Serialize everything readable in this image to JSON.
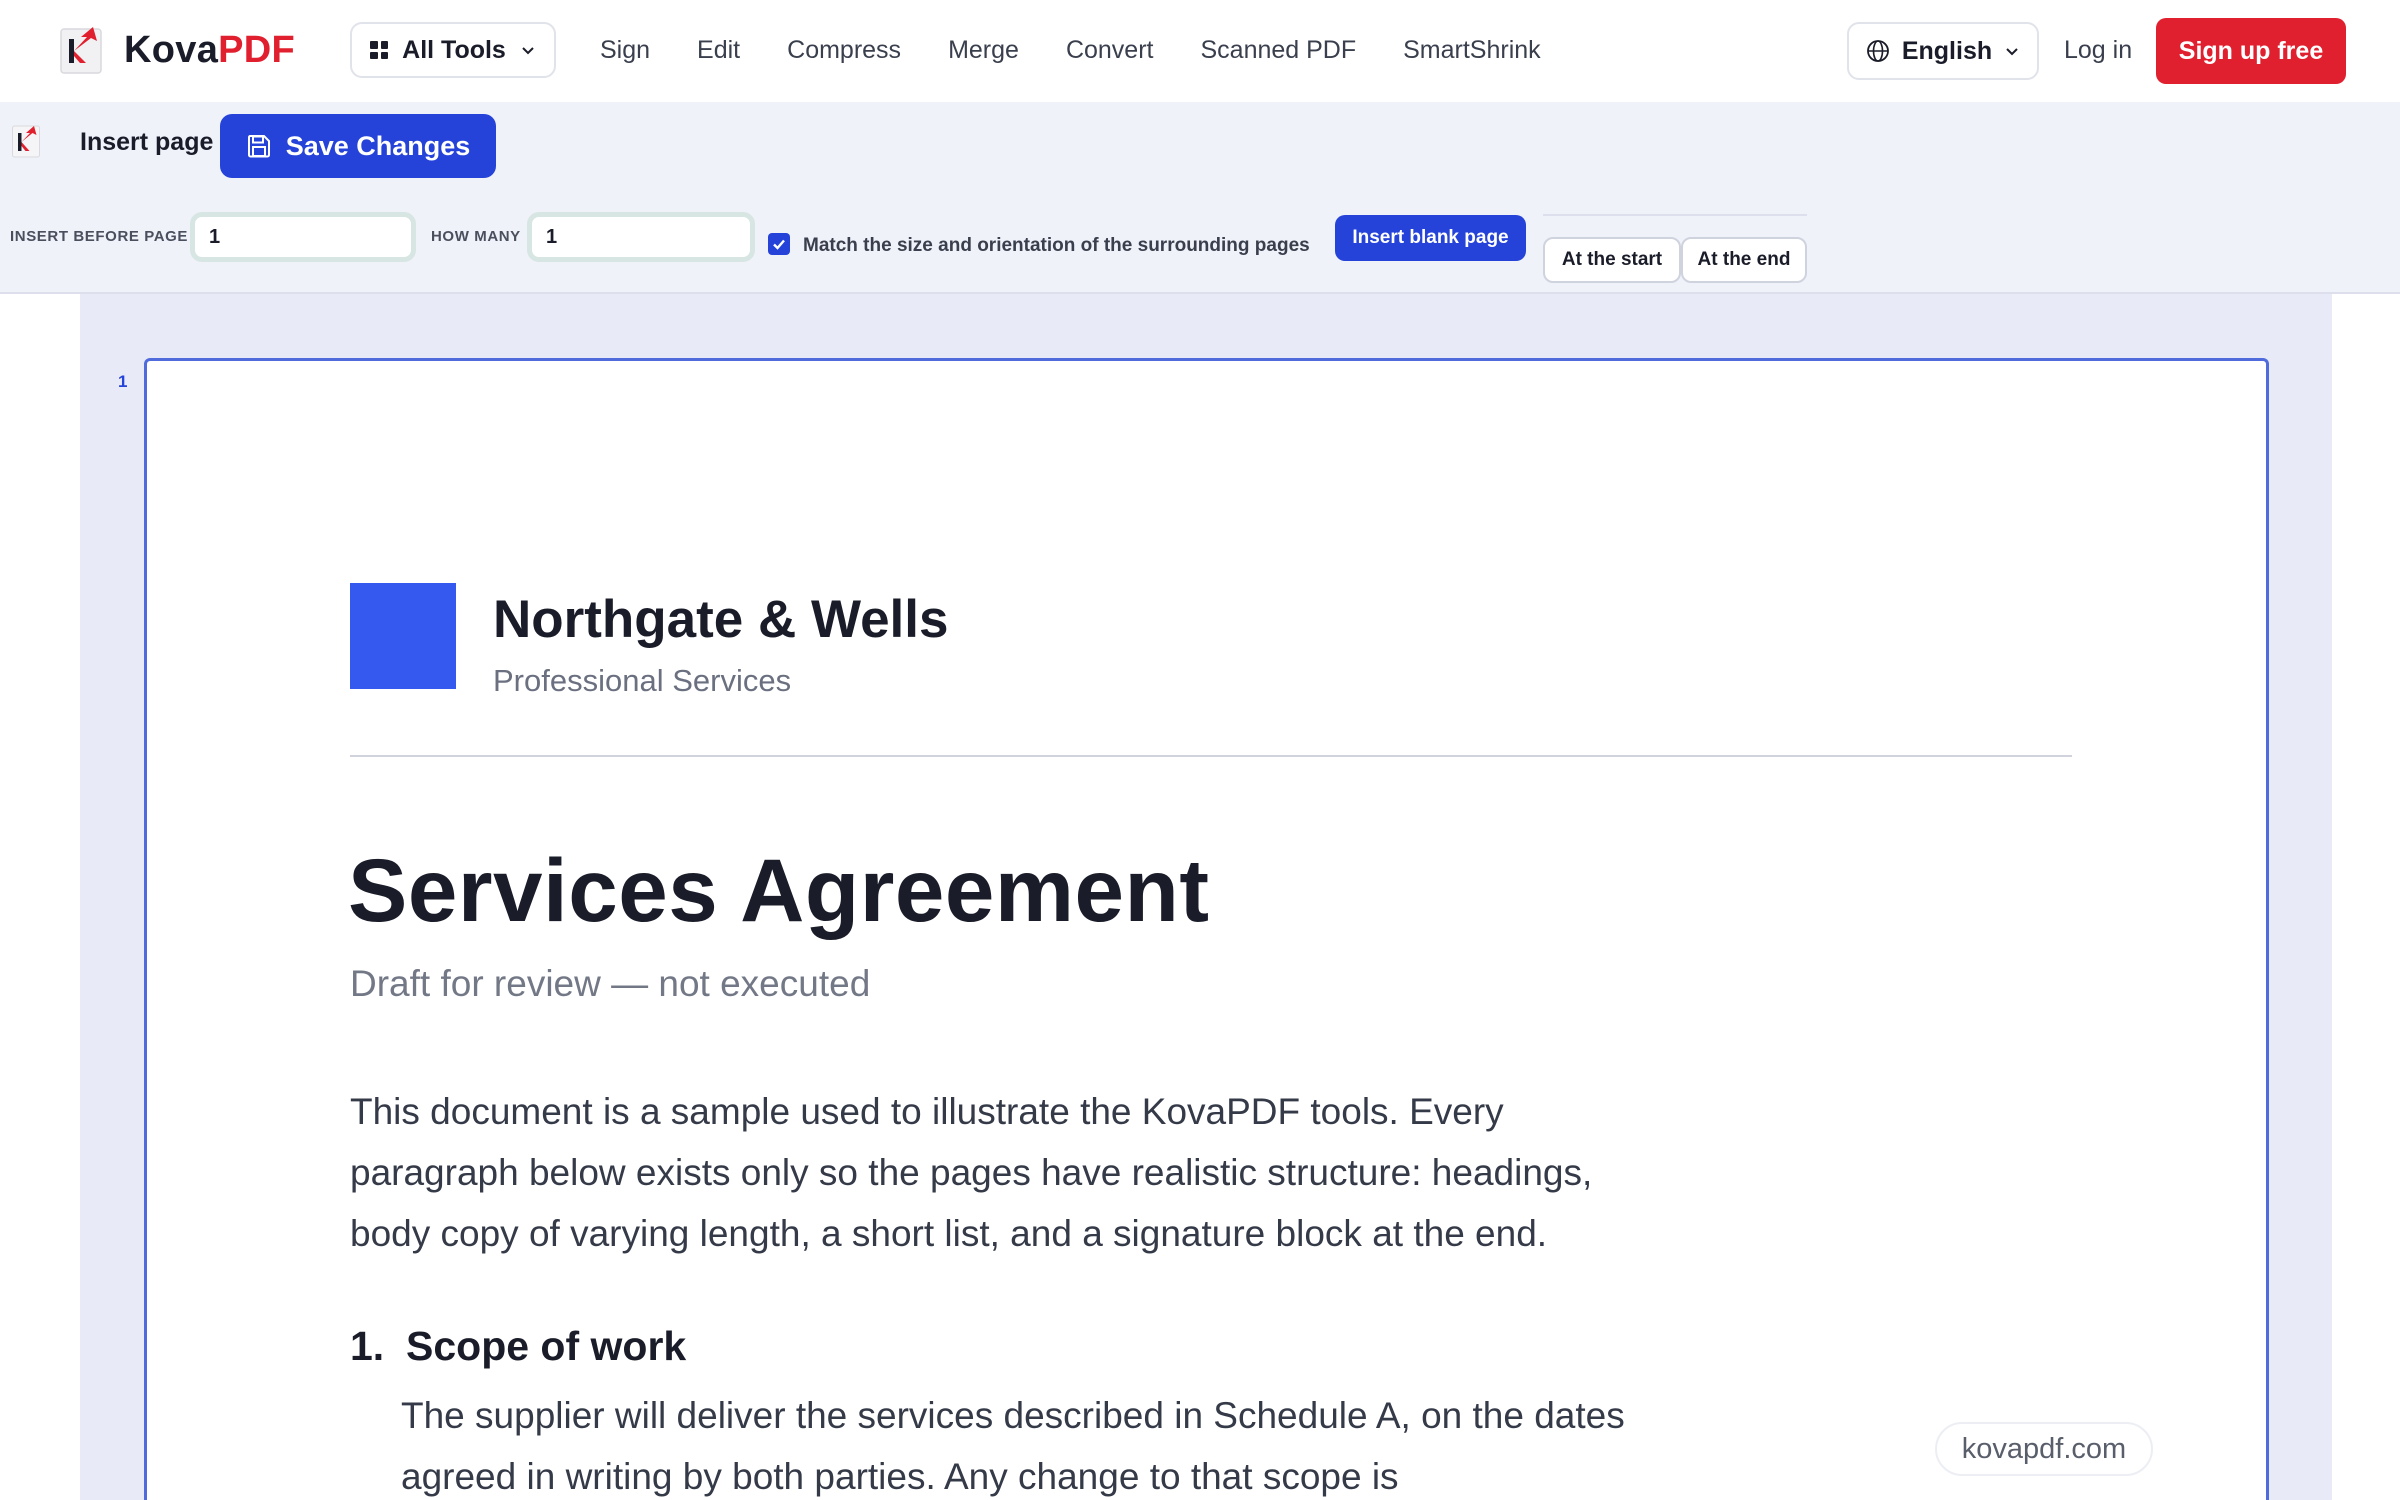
{
  "brand": {
    "name_part1": "Kova",
    "name_part2": "PDF",
    "logo_icon": "kovapdf-logo-icon",
    "accent": "#e0202e"
  },
  "nav": {
    "all_tools_label": "All Tools",
    "links": [
      "Sign",
      "Edit",
      "Compress",
      "Merge",
      "Convert",
      "Scanned PDF",
      "SmartShrink"
    ],
    "language": "English",
    "login": "Log in",
    "signup": "Sign up free"
  },
  "toolbar": {
    "title": "Insert page",
    "save_label": "Save Changes",
    "insert_before_label": "INSERT BEFORE PAGE",
    "insert_before_value": "1",
    "how_many_label": "HOW MANY",
    "how_many_value": "1",
    "match_size_checked": true,
    "match_size_label": "Match the size and orientation of the surrounding pages",
    "insert_blank_label": "Insert blank page",
    "at_start_label": "At the start",
    "at_end_label": "At the end",
    "primary_color": "#2543d8"
  },
  "page": {
    "number": "1",
    "company": "Northgate & Wells",
    "tagline": "Professional Services",
    "title": "Services Agreement",
    "subtitle": "Draft for review — not executed",
    "intro": "This document is a sample used to illustrate the KovaPDF tools. Every paragraph below exists only so the pages have realistic structure: headings, body copy of varying length, a short list, and a signature block at the end.",
    "section_number": "1.",
    "section_title": "Scope of work",
    "section_body": "The supplier will deliver the services described in Schedule A, on the dates agreed in writing by both parties. Any change to that scope is",
    "logo_color": "#3558ee"
  },
  "watermark": "kovapdf.com"
}
